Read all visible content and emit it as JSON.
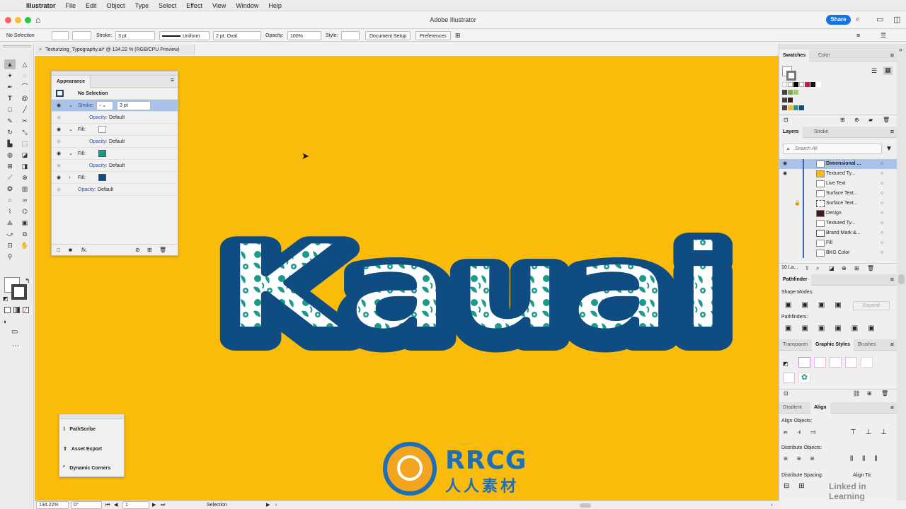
{
  "menubar": {
    "items": [
      "Illustrator",
      "File",
      "Edit",
      "Object",
      "Type",
      "Select",
      "Effect",
      "View",
      "Window",
      "Help"
    ]
  },
  "titlebar": {
    "title": "Adobe Illustrator",
    "share_label": "Share"
  },
  "control": {
    "selection_label": "No Selection",
    "stroke_label": "Stroke:",
    "stroke_value": "3 pt",
    "profile_value": "Uniform",
    "brush_value": "2 pt. Oval",
    "opacity_label": "Opacity:",
    "opacity_value": "100%",
    "style_label": "Style:",
    "document_setup": "Document Setup",
    "preferences": "Preferences"
  },
  "document": {
    "tab_title": "Texturizing_Typography.ai* @ 134.22 % (RGB/CPU Preview)",
    "close_glyph": "×"
  },
  "artwork": {
    "word": "Kauai",
    "bg_color": "#fbbb0b",
    "outline_color": "#0f4c81",
    "fill_color": "#1c9a8a"
  },
  "appearance": {
    "title": "Appearance",
    "header": "No Selection",
    "stroke_label": "Stroke:",
    "stroke_value": "3 pt",
    "fill_label": "Fill:",
    "opacity_label": "Opacity:",
    "opacity_value": "Default",
    "fx_label": "fx."
  },
  "plugins": {
    "items": [
      "PathScribe",
      "Asset Export",
      "Dynamic Corners"
    ]
  },
  "swatches": {
    "tabs": [
      "Swatches",
      "Color"
    ]
  },
  "layers": {
    "tabs": [
      "Layers",
      "Stroke"
    ],
    "search_placeholder": "Search All",
    "items": [
      "Dimensional ...",
      "Textured Ty...",
      "Live Text",
      "Surface Text...",
      "Surface Text...",
      "Design",
      "Textured Ty...",
      "Brand Mark &...",
      "Fill",
      "BKG Color"
    ],
    "count": "10 La..."
  },
  "pathfinder": {
    "title": "Pathfinder",
    "shape_modes": "Shape Modes:",
    "expand": "Expand",
    "pathfinders": "Pathfinders:"
  },
  "graphic_styles": {
    "tabs": [
      "Transparen",
      "Graphic Styles",
      "Brushes"
    ]
  },
  "align": {
    "tabs": [
      "Gradient",
      "Align"
    ],
    "align_objects": "Align Objects:",
    "distribute_objects": "Distribute Objects:",
    "distribute_spacing": "Distribute Spacing:",
    "align_to": "Align To:"
  },
  "status": {
    "zoom": "134.22%",
    "rotation": "0°",
    "artboard": "1",
    "tool": "Selection"
  },
  "watermark": {
    "brand": "RRCG",
    "chinese": "人人素材",
    "linkedin": "Linked in Learning"
  }
}
